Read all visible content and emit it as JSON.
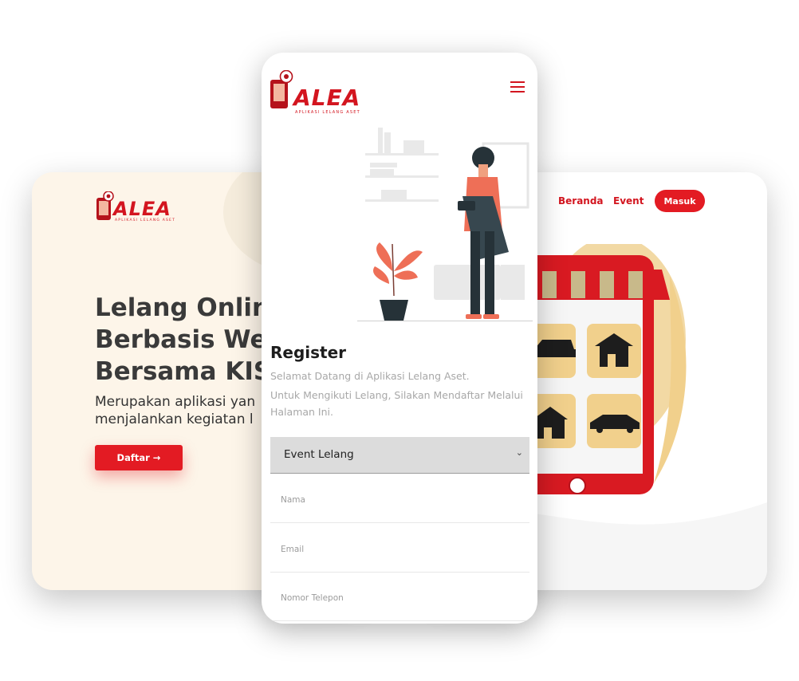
{
  "brand": {
    "name": "ALEA",
    "tagline": "APLIKASI LELANG ASET",
    "primary_color": "#e31b23",
    "text_red": "#d3151f"
  },
  "desktop_left": {
    "hero_title": "Lelang Onlin\nBerbasis We\nBersama KIS",
    "hero_subtitle": "Merupakan aplikasi yan\nmenjalankan kegiatan l",
    "cta_label": "Daftar →"
  },
  "desktop_right": {
    "nav": {
      "beranda": "Beranda",
      "event": "Event",
      "masuk": "Masuk"
    }
  },
  "mobile": {
    "menu_icon": "hamburger-icon",
    "register": {
      "title": "Register",
      "welcome": "Selamat Datang di Aplikasi Lelang Aset.",
      "instruction": "Untuk Mengikuti Lelang, Silakan Mendaftar Melalui Halaman Ini.",
      "event_select": {
        "selected": "Event Lelang",
        "chevron_icon": "chevron-down-icon"
      },
      "fields": {
        "nama_placeholder": "Nama",
        "email_placeholder": "Email",
        "telepon_placeholder": "Nomor Telepon"
      }
    }
  }
}
